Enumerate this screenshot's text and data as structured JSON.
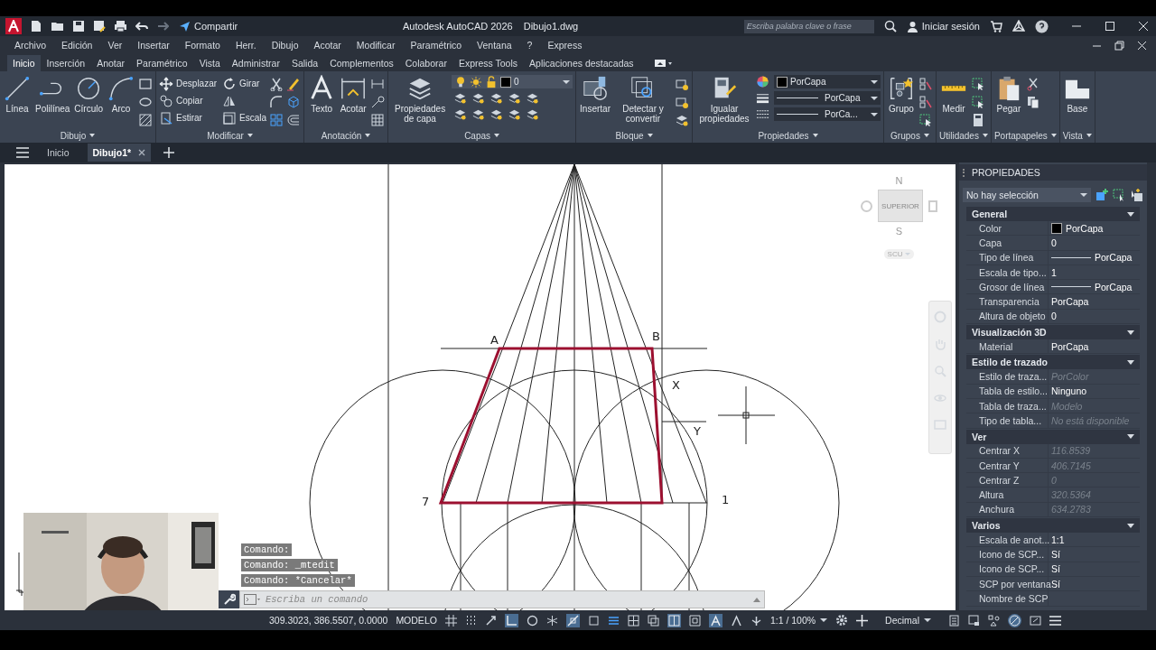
{
  "title_bar": {
    "share": "Compartir",
    "app_title": "Autodesk AutoCAD 2026",
    "file_name": "Dibujo1.dwg",
    "search_placeholder": "Escriba palabra clave o frase",
    "sign_in": "Iniciar sesión"
  },
  "menu_bar": [
    "Archivo",
    "Edición",
    "Ver",
    "Insertar",
    "Formato",
    "Herr.",
    "Dibujo",
    "Acotar",
    "Modificar",
    "Paramétrico",
    "Ventana",
    "?",
    "Express"
  ],
  "ribbon_tabs": [
    {
      "label": "Inicio",
      "selected": true
    },
    {
      "label": "Inserción",
      "selected": false
    },
    {
      "label": "Anotar",
      "selected": false
    },
    {
      "label": "Paramétrico",
      "selected": false
    },
    {
      "label": "Vista",
      "selected": false
    },
    {
      "label": "Administrar",
      "selected": false
    },
    {
      "label": "Salida",
      "selected": false
    },
    {
      "label": "Complementos",
      "selected": false
    },
    {
      "label": "Colaborar",
      "selected": false
    },
    {
      "label": "Express Tools",
      "selected": false
    },
    {
      "label": "Aplicaciones destacadas",
      "selected": false
    }
  ],
  "ribbon_panels": [
    {
      "title": "Dibujo",
      "large": [
        "Línea",
        "Polilínea",
        "Círculo",
        "Arco"
      ]
    },
    {
      "title": "Modificar",
      "small": [
        "Desplazar",
        "Copiar",
        "Estirar",
        "Girar",
        "Escala"
      ]
    },
    {
      "title": "Anotación",
      "large": [
        "Texto",
        "Acotar"
      ]
    },
    {
      "title": "Capas",
      "large": [
        "Propiedades de capa"
      ],
      "combos": [
        "0"
      ]
    },
    {
      "title": "Bloque",
      "large": [
        "Insertar",
        "Detectar y convertir"
      ]
    },
    {
      "title": "Propiedades",
      "large": [
        "Igualar propiedades"
      ],
      "combos": [
        "PorCapa",
        "PorCapa",
        "PorCa..."
      ]
    },
    {
      "title": "Grupos",
      "large": [
        "Grupo"
      ]
    },
    {
      "title": "Utilidades",
      "large": [
        "Medir"
      ]
    },
    {
      "title": "Portapapeles",
      "large": [
        "Pegar"
      ]
    },
    {
      "title": "Vista",
      "large": [
        "Base"
      ]
    }
  ],
  "file_tabs": [
    {
      "label": "Inicio",
      "selected": false
    },
    {
      "label": "Dibujo1*",
      "selected": true
    }
  ],
  "drawing_labels": [
    "A",
    "B",
    "X",
    "Y",
    "7",
    "1"
  ],
  "view_cube": {
    "north": "N",
    "south": "S",
    "face": "SUPERIOR",
    "ucs": "SCU"
  },
  "command_history": [
    "Comando:",
    "Comando: _mtedit",
    "Comando: *Cancelar*"
  ],
  "command_line": {
    "placeholder": "Escriba un comando"
  },
  "webcam": {
    "kind": "picture"
  },
  "properties_panel": {
    "title": "PROPIEDADES",
    "selection": "No hay selección",
    "sections": [
      {
        "title": "General",
        "expanded": true,
        "rows": [
          {
            "label": "Color",
            "value": "PorCapa",
            "kind": "swatch",
            "disabled": false
          },
          {
            "label": "Capa",
            "value": "0",
            "kind": "plain",
            "disabled": false
          },
          {
            "label": "Tipo de línea",
            "value": "PorCapa",
            "kind": "line",
            "disabled": false
          },
          {
            "label": "Escala de tipo...",
            "value": "1",
            "kind": "plain",
            "disabled": false
          },
          {
            "label": "Grosor de línea",
            "value": "PorCapa",
            "kind": "line",
            "disabled": false
          },
          {
            "label": "Transparencia",
            "value": "PorCapa",
            "kind": "plain",
            "disabled": false
          },
          {
            "label": "Altura de objeto",
            "value": "0",
            "kind": "plain",
            "disabled": false
          }
        ]
      },
      {
        "title": "Visualización 3D",
        "expanded": true,
        "rows": [
          {
            "label": "Material",
            "value": "PorCapa",
            "kind": "plain",
            "disabled": false
          }
        ]
      },
      {
        "title": "Estilo de trazado",
        "expanded": true,
        "rows": [
          {
            "label": "Estilo de traza...",
            "value": "PorColor",
            "kind": "plain",
            "disabled": true
          },
          {
            "label": "Tabla de estilo...",
            "value": "Ninguno",
            "kind": "plain",
            "disabled": false
          },
          {
            "label": "Tabla de traza...",
            "value": "Modelo",
            "kind": "plain",
            "disabled": true
          },
          {
            "label": "Tipo de tabla...",
            "value": "No está disponible",
            "kind": "plain",
            "disabled": true
          }
        ]
      },
      {
        "title": "Ver",
        "expanded": true,
        "rows": [
          {
            "label": "Centrar X",
            "value": "116.8539",
            "kind": "plain",
            "disabled": true
          },
          {
            "label": "Centrar Y",
            "value": "406.7145",
            "kind": "plain",
            "disabled": true
          },
          {
            "label": "Centrar Z",
            "value": "0",
            "kind": "plain",
            "disabled": true
          },
          {
            "label": "Altura",
            "value": "320.5364",
            "kind": "plain",
            "disabled": true
          },
          {
            "label": "Anchura",
            "value": "634.2783",
            "kind": "plain",
            "disabled": true
          }
        ]
      },
      {
        "title": "Varios",
        "expanded": true,
        "rows": [
          {
            "label": "Escala de anot...",
            "value": "1:1",
            "kind": "plain",
            "disabled": false
          },
          {
            "label": "Icono de SCP...",
            "value": "Sí",
            "kind": "plain",
            "disabled": false
          },
          {
            "label": "Icono de SCP...",
            "value": "Sí",
            "kind": "plain",
            "disabled": false
          },
          {
            "label": "SCP por ventana",
            "value": "Sí",
            "kind": "plain",
            "disabled": false
          },
          {
            "label": "Nombre de SCP"
          }
        ]
      }
    ]
  },
  "status_bar": {
    "coordinates": "309.3023, 386.5507, 0.0000",
    "space": "MODELO",
    "scale": "1:1 / 100%",
    "units": "Decimal"
  }
}
